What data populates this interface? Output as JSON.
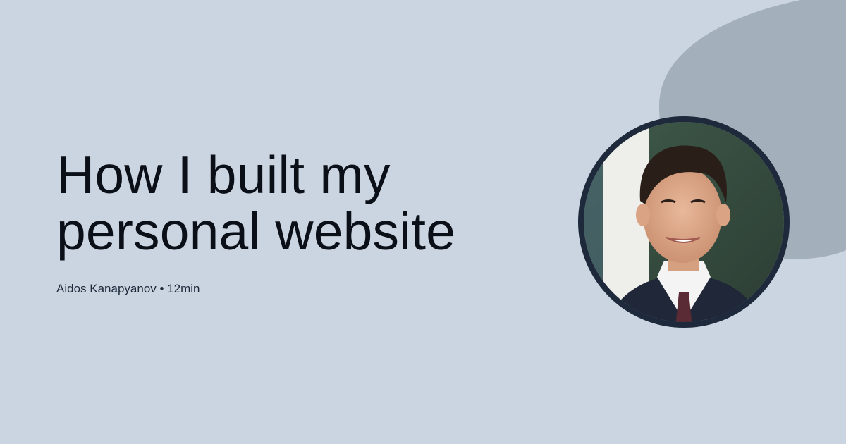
{
  "post": {
    "title_lines": [
      "How I built my",
      "personal website"
    ],
    "author": "Aidos Kanapyanov",
    "separator": "•",
    "reading_time": "12min"
  },
  "colors": {
    "background": "#cbd5e1",
    "blob": "#a4afbc",
    "avatar_border": "#1e293b",
    "text": "#0b0f17"
  }
}
